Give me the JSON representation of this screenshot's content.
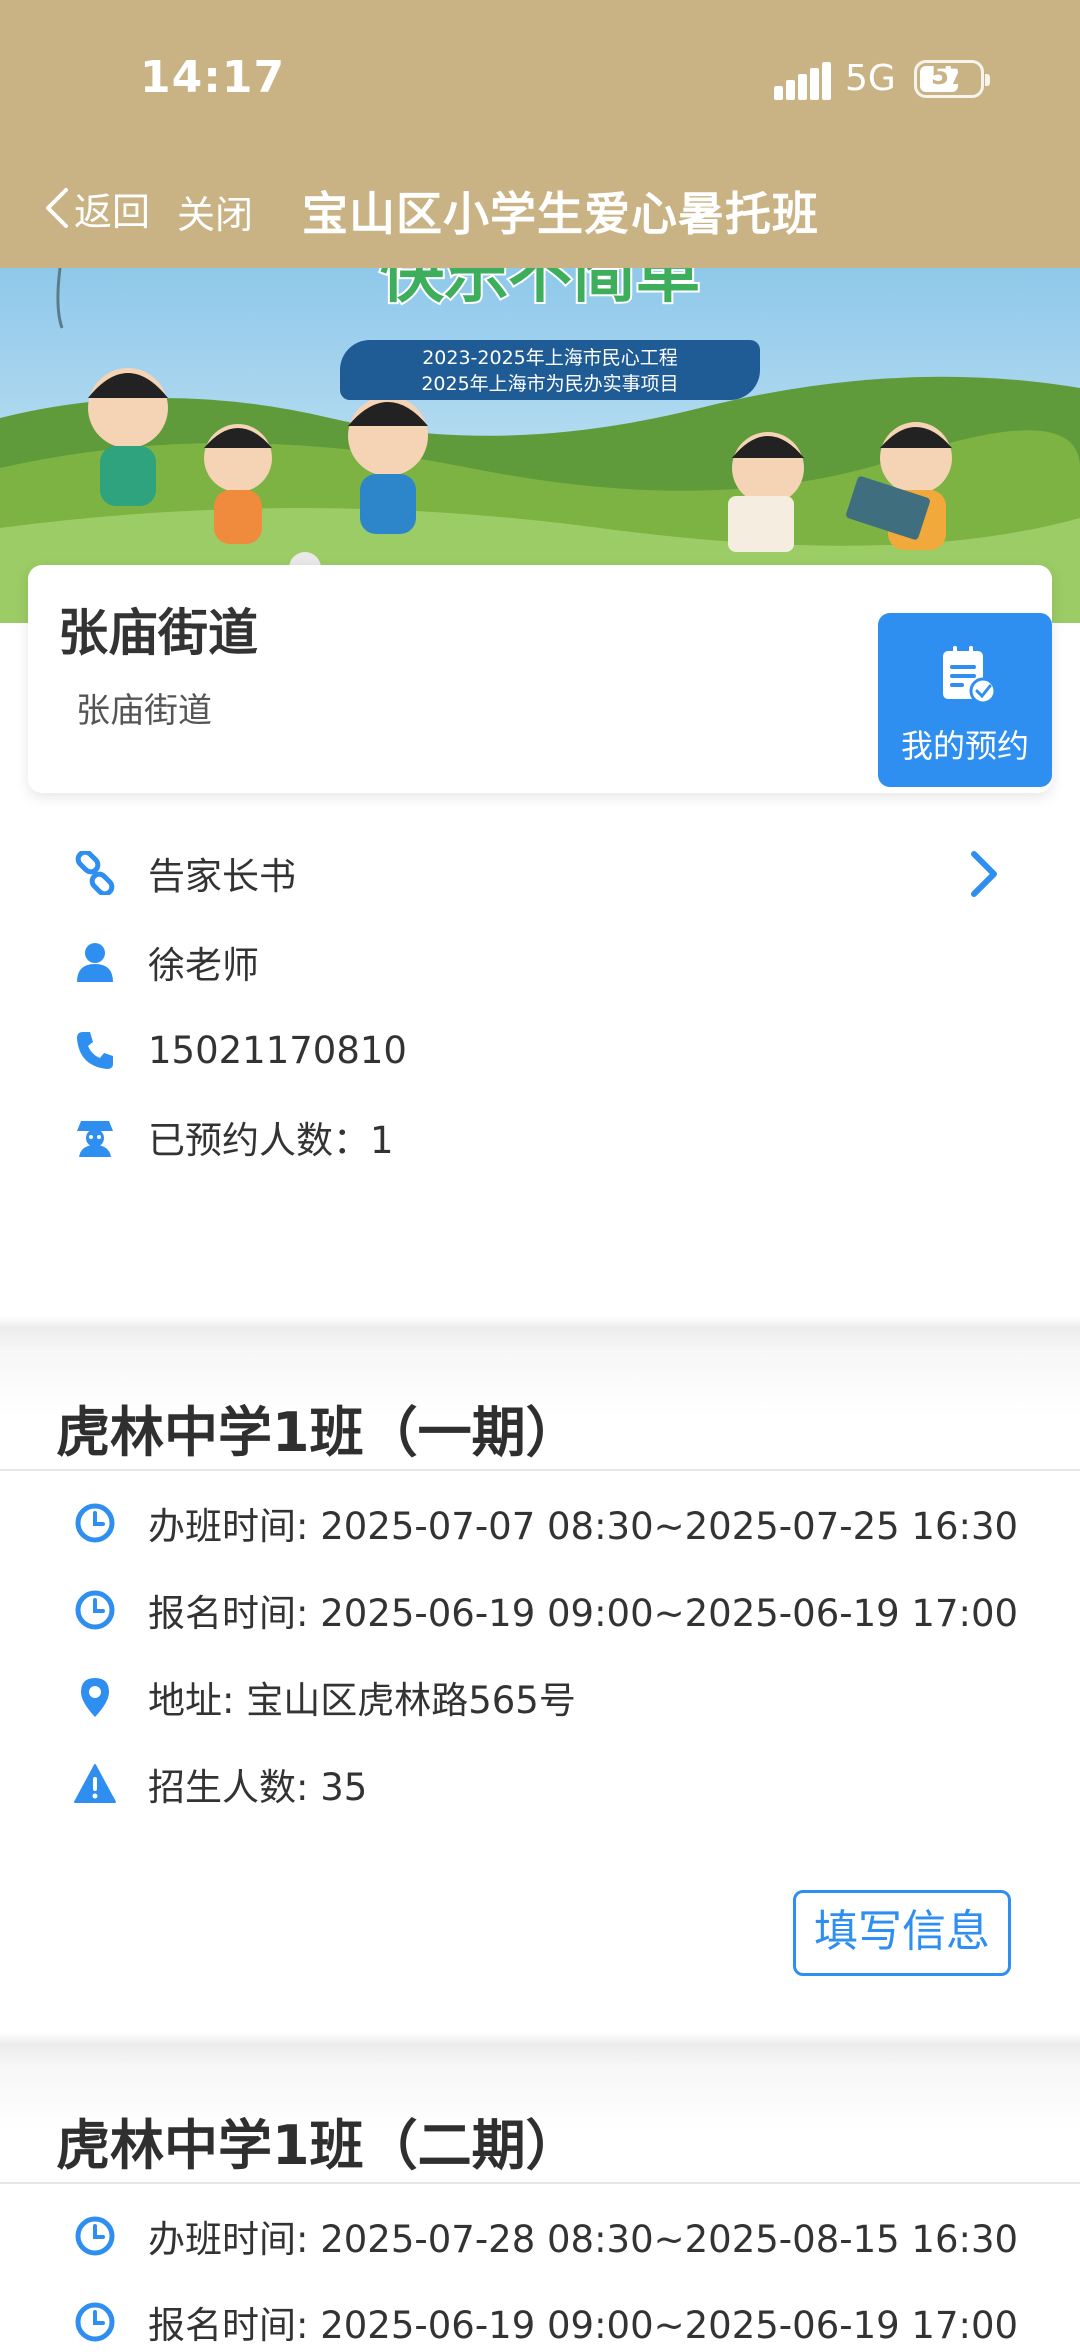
{
  "status_bar": {
    "time": "14:17",
    "network": "5G",
    "battery": "57"
  },
  "nav": {
    "back_label": "返回",
    "close_label": "关闭",
    "title": "宝山区小学生爱心暑托班"
  },
  "banner": {
    "headline": "快乐不简单",
    "badge_line1": "2023-2025年上海市民心工程",
    "badge_line2": "2025年上海市为民办实事项目"
  },
  "venue": {
    "title": "张庙街道",
    "subtitle": "张庙街道",
    "my_booking_label": "我的预约",
    "letter_label": "告家长书",
    "teacher": "徐老师",
    "phone": "15021170810",
    "booked_count_label": "已预约人数：1"
  },
  "classes": [
    {
      "title": "虎林中学1班（一期）",
      "class_time": "办班时间: 2025-07-07 08:30~2025-07-25 16:30",
      "signup_time": "报名时间: 2025-06-19 09:00~2025-06-19 17:00",
      "address": "地址: 宝山区虎林路565号",
      "capacity": "招生人数: 35",
      "fill_button_label": "填写信息"
    },
    {
      "title": "虎林中学1班（二期）",
      "class_time": "办班时间: 2025-07-28 08:30~2025-08-15 16:30",
      "signup_time": "报名时间: 2025-06-19 09:00~2025-06-19 17:00"
    }
  ],
  "colors": {
    "header": "#c9b384",
    "accent": "#2f8ff0",
    "text": "#333333"
  }
}
